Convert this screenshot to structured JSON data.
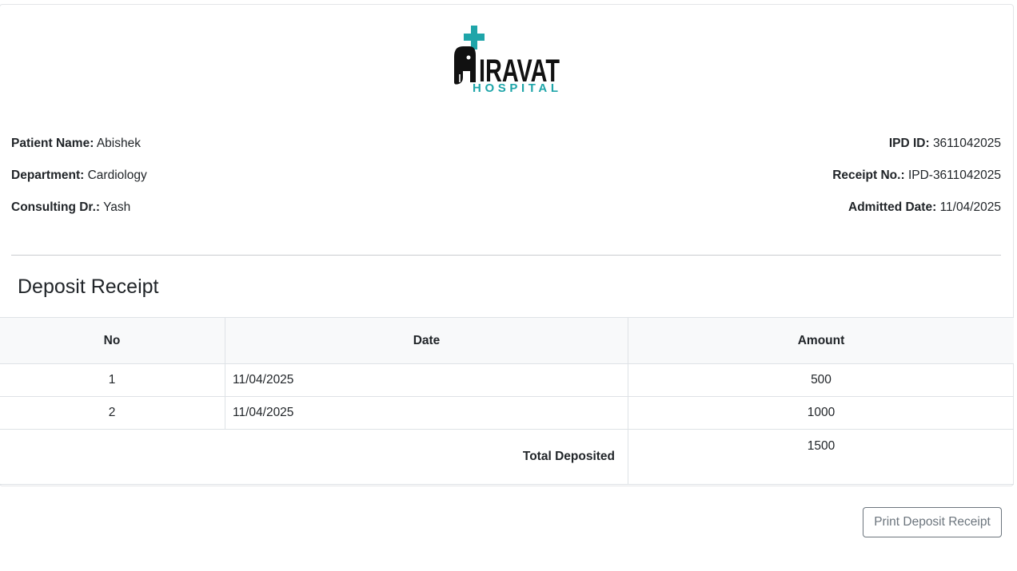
{
  "hospital": {
    "logo_text_main": "IRAVAT",
    "logo_text_sub": "HOSPITAL",
    "logo_initial": "A",
    "accent_color": "#1fa5a9"
  },
  "patient": {
    "name_label": "Patient Name:",
    "name_value": "Abishek",
    "department_label": "Department:",
    "department_value": "Cardiology",
    "doctor_label": "Consulting Dr.:",
    "doctor_value": "Yash",
    "ipd_label": "IPD ID:",
    "ipd_value": "3611042025",
    "receipt_label": "Receipt No.:",
    "receipt_value": "IPD-3611042025",
    "admitted_label": "Admitted Date:",
    "admitted_value": "11/04/2025"
  },
  "receipt": {
    "title": "Deposit Receipt",
    "columns": [
      "No",
      "Date",
      "Amount"
    ],
    "rows": [
      {
        "no": "1",
        "date": "11/04/2025",
        "amount": "500"
      },
      {
        "no": "2",
        "date": "11/04/2025",
        "amount": "1000"
      }
    ],
    "total_label": "Total Deposited",
    "total_value": "1500"
  },
  "actions": {
    "print_label": "Print Deposit Receipt"
  }
}
